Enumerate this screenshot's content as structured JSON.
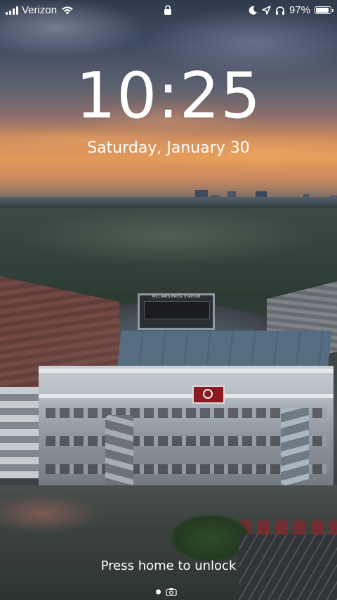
{
  "status_bar": {
    "carrier": "Verizon",
    "battery_percent": "97%",
    "battery_level": 0.97,
    "signal_bars": 4,
    "icons": [
      "signal-icon",
      "wifi-icon",
      "lock-icon",
      "do-not-disturb-icon",
      "location-icon",
      "headphones-icon",
      "battery-icon"
    ]
  },
  "lock_screen": {
    "time": "10:25",
    "date": "Saturday, January 30",
    "unlock_hint": "Press home to unlock",
    "wallpaper_sign": "WILLIAMS-BRICE STADIUM"
  },
  "page_indicator": {
    "icons": [
      "page-dot-icon",
      "camera-icon"
    ]
  },
  "colors": {
    "text": "#ffffff",
    "sign_red": "#8d1a22"
  }
}
